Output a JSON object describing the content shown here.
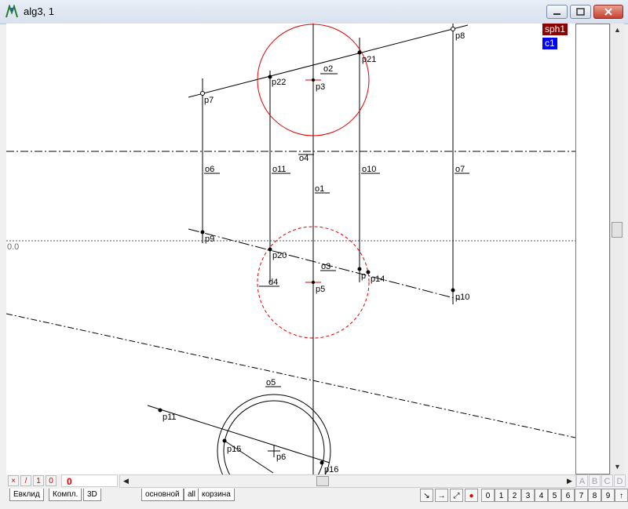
{
  "window": {
    "title": "alg3, 1",
    "minimize": "",
    "maximize": "",
    "close": ""
  },
  "canvas": {
    "axis_label": "0.0",
    "tags": [
      {
        "label": "sph1",
        "color": "#8b0000"
      },
      {
        "label": "c1",
        "color": "#0000ff"
      }
    ],
    "points": [
      "p3",
      "p5",
      "p6",
      "p7",
      "p8",
      "p9",
      "p10",
      "p11",
      "p14",
      "p16",
      "p20",
      "p21",
      "p22",
      "p15",
      "p25"
    ],
    "lines": [
      "o1",
      "o2",
      "o3",
      "o4",
      "o5",
      "o6",
      "o7",
      "o10",
      "o11",
      "d4"
    ]
  },
  "bottom_toolbar": {
    "mini_buttons": [
      "×",
      "/",
      "1",
      "0"
    ],
    "counter": "0",
    "abcd": [
      "A",
      "B",
      "C",
      "D"
    ]
  },
  "tabs": [
    "Евклид",
    "Компл.",
    "3D",
    "основной",
    "all",
    "корзина"
  ],
  "tool_buttons": [
    "↘",
    "→",
    "⤢",
    "●"
  ],
  "layer_buttons": [
    "0",
    "1",
    "2",
    "3",
    "4",
    "5",
    "6",
    "7",
    "8",
    "9",
    "↑"
  ]
}
